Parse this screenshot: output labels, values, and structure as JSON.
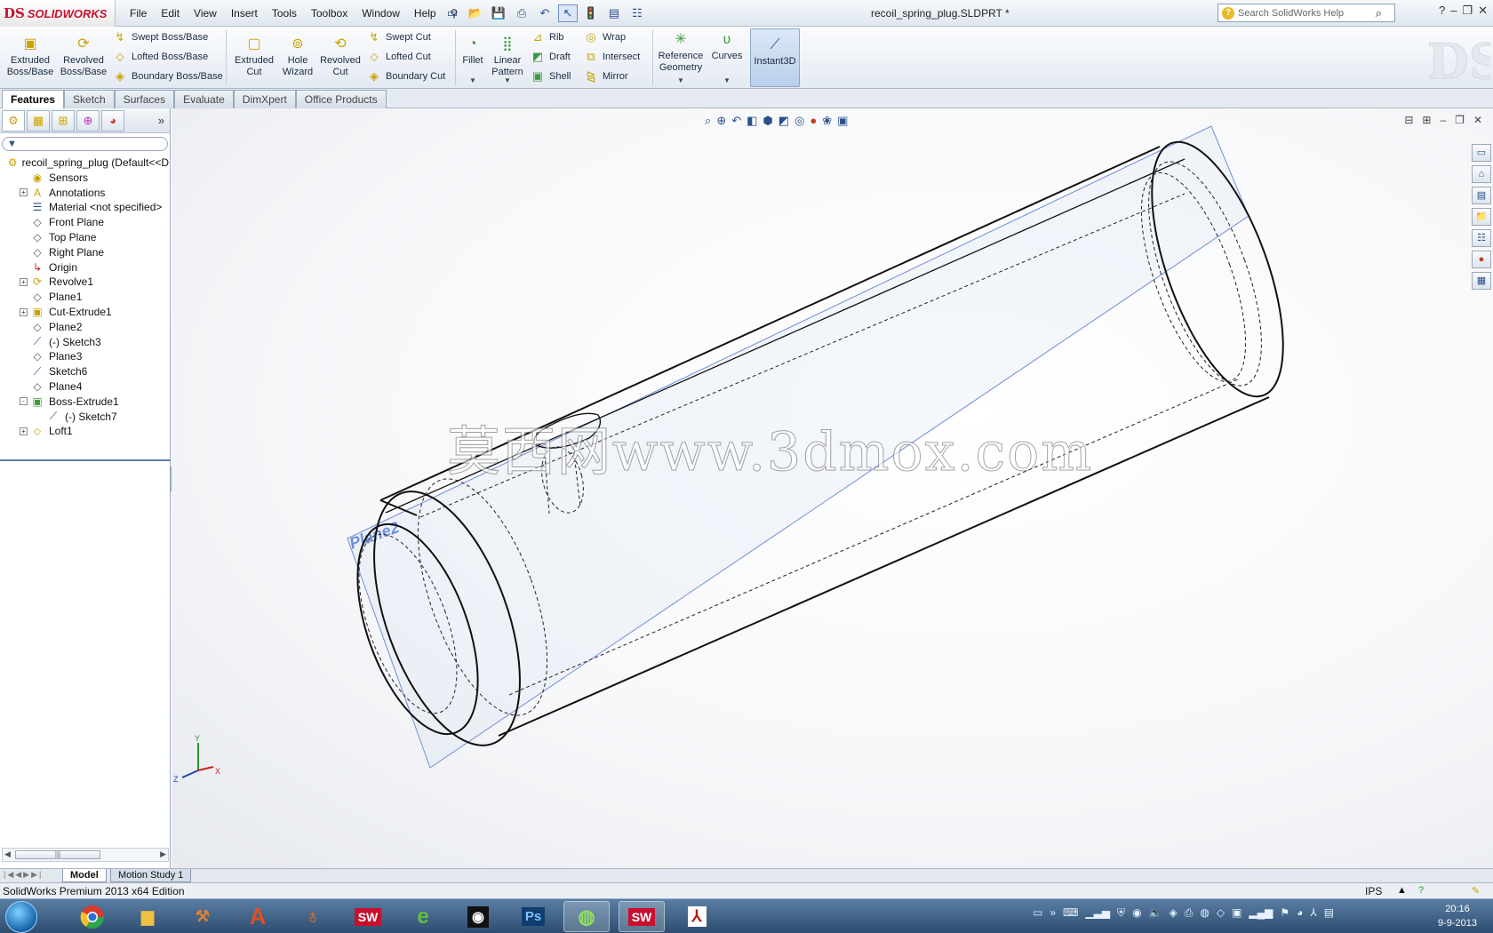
{
  "app": {
    "logo_ds": "DS",
    "logo_text": "SOLIDWORKS",
    "doc_title": "recoil_spring_plug.SLDPRT *",
    "help_search_placeholder": "Search SolidWorks Help"
  },
  "menu": [
    "File",
    "Edit",
    "View",
    "Insert",
    "Tools",
    "Toolbox",
    "Window",
    "Help"
  ],
  "ribbon": {
    "extruded_boss": "Extruded Boss/Base",
    "revolved_boss": "Revolved Boss/Base",
    "swept_boss": "Swept Boss/Base",
    "lofted_boss": "Lofted Boss/Base",
    "boundary_boss": "Boundary Boss/Base",
    "extruded_cut": "Extruded Cut",
    "hole_wizard": "Hole Wizard",
    "revolved_cut": "Revolved Cut",
    "swept_cut": "Swept Cut",
    "lofted_cut": "Lofted Cut",
    "boundary_cut": "Boundary Cut",
    "fillet": "Fillet",
    "linear_pattern": "Linear Pattern",
    "rib": "Rib",
    "draft": "Draft",
    "shell": "Shell",
    "wrap": "Wrap",
    "intersect": "Intersect",
    "mirror": "Mirror",
    "reference_geometry": "Reference Geometry",
    "curves": "Curves",
    "instant3d": "Instant3D"
  },
  "tabs": [
    "Features",
    "Sketch",
    "Surfaces",
    "Evaluate",
    "DimXpert",
    "Office Products"
  ],
  "tree": [
    {
      "label": "recoil_spring_plug  (Default<<D",
      "exp": "none",
      "indent": 0,
      "icon": "part-icon"
    },
    {
      "label": "Sensors",
      "exp": "none",
      "indent": 1,
      "icon": "sensor-icon"
    },
    {
      "label": "Annotations",
      "exp": "+",
      "indent": 1,
      "icon": "annotation-icon"
    },
    {
      "label": "Material <not specified>",
      "exp": "none",
      "indent": 1,
      "icon": "material-icon"
    },
    {
      "label": "Front Plane",
      "exp": "none",
      "indent": 1,
      "icon": "plane-icon"
    },
    {
      "label": "Top Plane",
      "exp": "none",
      "indent": 1,
      "icon": "plane-icon"
    },
    {
      "label": "Right Plane",
      "exp": "none",
      "indent": 1,
      "icon": "plane-icon"
    },
    {
      "label": "Origin",
      "exp": "none",
      "indent": 1,
      "icon": "origin-icon"
    },
    {
      "label": "Revolve1",
      "exp": "+",
      "indent": 1,
      "icon": "revolve-icon"
    },
    {
      "label": "Plane1",
      "exp": "none",
      "indent": 1,
      "icon": "plane-icon"
    },
    {
      "label": "Cut-Extrude1",
      "exp": "+",
      "indent": 1,
      "icon": "cut-extrude-icon"
    },
    {
      "label": "Plane2",
      "exp": "none",
      "indent": 1,
      "icon": "plane-icon"
    },
    {
      "label": "(-) Sketch3",
      "exp": "none",
      "indent": 1,
      "icon": "sketch-icon"
    },
    {
      "label": "Plane3",
      "exp": "none",
      "indent": 1,
      "icon": "plane-icon"
    },
    {
      "label": "Sketch6",
      "exp": "none",
      "indent": 1,
      "icon": "sketch-icon"
    },
    {
      "label": "Plane4",
      "exp": "none",
      "indent": 1,
      "icon": "plane-icon"
    },
    {
      "label": "Boss-Extrude1",
      "exp": "-",
      "indent": 1,
      "icon": "boss-extrude-icon"
    },
    {
      "label": "(-) Sketch7",
      "exp": "none",
      "indent": 2,
      "icon": "sketch-icon"
    },
    {
      "label": "Loft1",
      "exp": "+",
      "indent": 1,
      "icon": "loft-icon"
    }
  ],
  "viewport": {
    "plane_label": "Plane2",
    "watermark": "莫西网www.3dmox.com",
    "axis_x": "X",
    "axis_y": "Y",
    "axis_z": "Z"
  },
  "bottom_tabs": [
    "Model",
    "Motion Study 1"
  ],
  "status": {
    "text": "SolidWorks Premium 2013 x64 Edition",
    "units": "IPS"
  },
  "clock": {
    "time": "20:16",
    "date": "9-9-2013"
  },
  "colors": {
    "accent_blue": "#2a4f8a",
    "plane_blue": "#6f8fd6",
    "brand_red": "#c8102e"
  }
}
